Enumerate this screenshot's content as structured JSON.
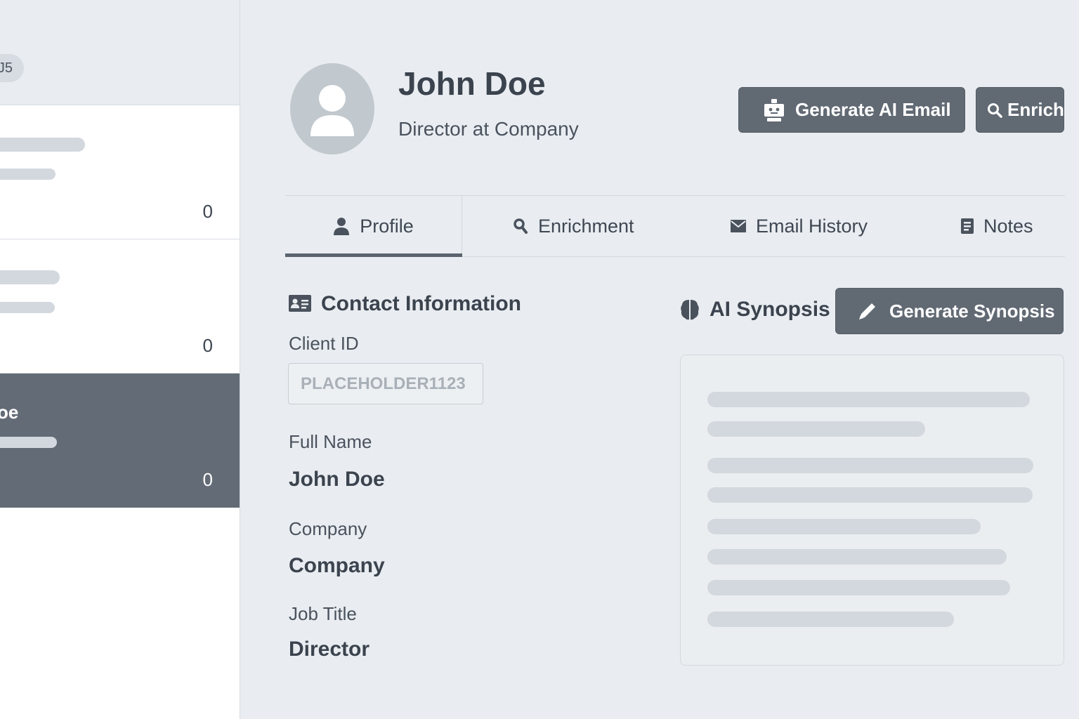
{
  "sidebar": {
    "count_pill": "J5",
    "cards": [
      {
        "count": "0"
      },
      {
        "count": "0"
      },
      {
        "name": "oe",
        "count": "0",
        "selected": true
      }
    ]
  },
  "header": {
    "name": "John Doe",
    "subtitle": "Director at Company",
    "generate_email_label": "Generate AI Email",
    "enrich_label": "Enrich"
  },
  "tabs": [
    {
      "label": "Profile",
      "icon": "person-icon",
      "active": true
    },
    {
      "label": "Enrichment",
      "icon": "search-icon"
    },
    {
      "label": "Email History",
      "icon": "envelope-icon"
    },
    {
      "label": "Notes",
      "icon": "notes-icon"
    }
  ],
  "contact": {
    "title": "Contact Information",
    "client_id_label": "Client ID",
    "client_id_placeholder": "PLACEHOLDER1123",
    "full_name_label": "Full Name",
    "full_name": "John Doe",
    "company_label": "Company",
    "company": "Company",
    "job_title_label": "Job Title",
    "job_title": "Director"
  },
  "synopsis": {
    "title": "AI Synopsis",
    "generate_label": "Generate Synopsis"
  },
  "colors": {
    "background": "#e9edf1",
    "button": "#616973",
    "selected_card": "#636b76",
    "skeleton": "#d3d8de"
  }
}
